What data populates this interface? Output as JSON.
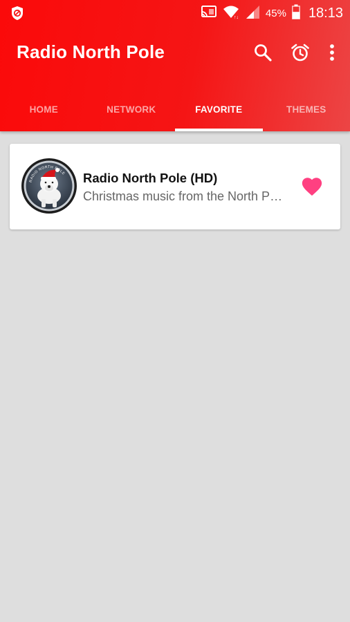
{
  "status_bar": {
    "battery_percent": "45%",
    "time": "18:13",
    "icons": [
      "shield-icon",
      "cast-icon",
      "wifi-icon",
      "signal-icon",
      "battery-icon"
    ]
  },
  "app_bar": {
    "title": "Radio North Pole",
    "actions": [
      "search-icon",
      "alarm-clock-icon",
      "more-vert-icon"
    ]
  },
  "tabs": [
    {
      "label": "HOME",
      "active": false
    },
    {
      "label": "NETWORK",
      "active": false
    },
    {
      "label": "FAVORITE",
      "active": true
    },
    {
      "label": "THEMES",
      "active": false
    }
  ],
  "favorites": [
    {
      "title": "Radio North Pole (HD)",
      "subtitle": "Christmas music from the North Pole",
      "logo_ring_text": "RADIO NORTH POLE",
      "favorited": true
    }
  ],
  "colors": {
    "primary": "#fb0a0a",
    "primary_light": "#ec4545",
    "background": "#dedede",
    "heart": "#ff4081"
  }
}
